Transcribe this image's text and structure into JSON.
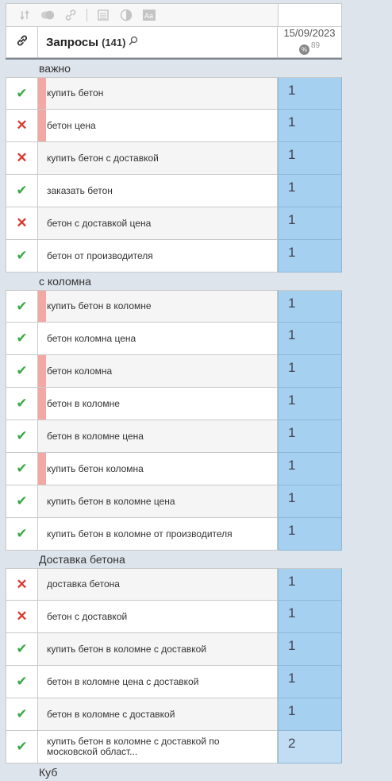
{
  "toolbar": {
    "icons": [
      "sort-icon",
      "toggle-icon",
      "link-off-icon",
      "list-icon",
      "contrast-icon",
      "font-icon"
    ]
  },
  "header": {
    "title": "Запросы",
    "count": "(141)",
    "date": "15/09/2023",
    "percent_value": "89"
  },
  "colors": {
    "ok": "#3aaa48",
    "fail": "#d93a2f",
    "position_bg": "#a6d0ef",
    "marker": "#f4a8a4"
  },
  "groups": [
    {
      "label": "важно",
      "rows": [
        {
          "status": "ok",
          "keyword": "купить бетон",
          "marked": true,
          "pos": "1"
        },
        {
          "status": "fail",
          "keyword": "бетон цена",
          "marked": true,
          "pos": "1"
        },
        {
          "status": "fail",
          "keyword": "купить бетон с доставкой",
          "marked": false,
          "pos": "1"
        },
        {
          "status": "ok",
          "keyword": "заказать бетон",
          "marked": false,
          "pos": "1"
        },
        {
          "status": "fail",
          "keyword": "бетон с доставкой цена",
          "marked": false,
          "pos": "1"
        },
        {
          "status": "ok",
          "keyword": "бетон от производителя",
          "marked": false,
          "pos": "1"
        }
      ]
    },
    {
      "label": "с коломна",
      "rows": [
        {
          "status": "ok",
          "keyword": "купить бетон в коломне",
          "marked": true,
          "pos": "1"
        },
        {
          "status": "ok",
          "keyword": "бетон коломна цена",
          "marked": false,
          "pos": "1"
        },
        {
          "status": "ok",
          "keyword": "бетон коломна",
          "marked": true,
          "pos": "1"
        },
        {
          "status": "ok",
          "keyword": "бетон в коломне",
          "marked": true,
          "pos": "1"
        },
        {
          "status": "ok",
          "keyword": "бетон в коломне цена",
          "marked": false,
          "pos": "1"
        },
        {
          "status": "ok",
          "keyword": "купить бетон коломна",
          "marked": true,
          "pos": "1"
        },
        {
          "status": "ok",
          "keyword": "купить бетон в коломне цена",
          "marked": false,
          "pos": "1"
        },
        {
          "status": "ok",
          "keyword": "купить бетон в коломне от производителя",
          "marked": false,
          "pos": "1"
        }
      ]
    },
    {
      "label": "Доставка бетона",
      "rows": [
        {
          "status": "fail",
          "keyword": "доставка бетона",
          "marked": false,
          "pos": "1"
        },
        {
          "status": "fail",
          "keyword": "бетон с доставкой",
          "marked": false,
          "pos": "1"
        },
        {
          "status": "ok",
          "keyword": "купить бетон в коломне с доставкой",
          "marked": false,
          "pos": "1"
        },
        {
          "status": "ok",
          "keyword": "бетон в коломне цена с доставкой",
          "marked": false,
          "pos": "1"
        },
        {
          "status": "ok",
          "keyword": "бетон в коломне с доставкой",
          "marked": false,
          "pos": "1"
        },
        {
          "status": "ok",
          "keyword": "купить бетон в коломне с доставкой по московской област...",
          "marked": false,
          "pos": "2"
        }
      ]
    },
    {
      "label": "Куб",
      "rows": []
    }
  ]
}
